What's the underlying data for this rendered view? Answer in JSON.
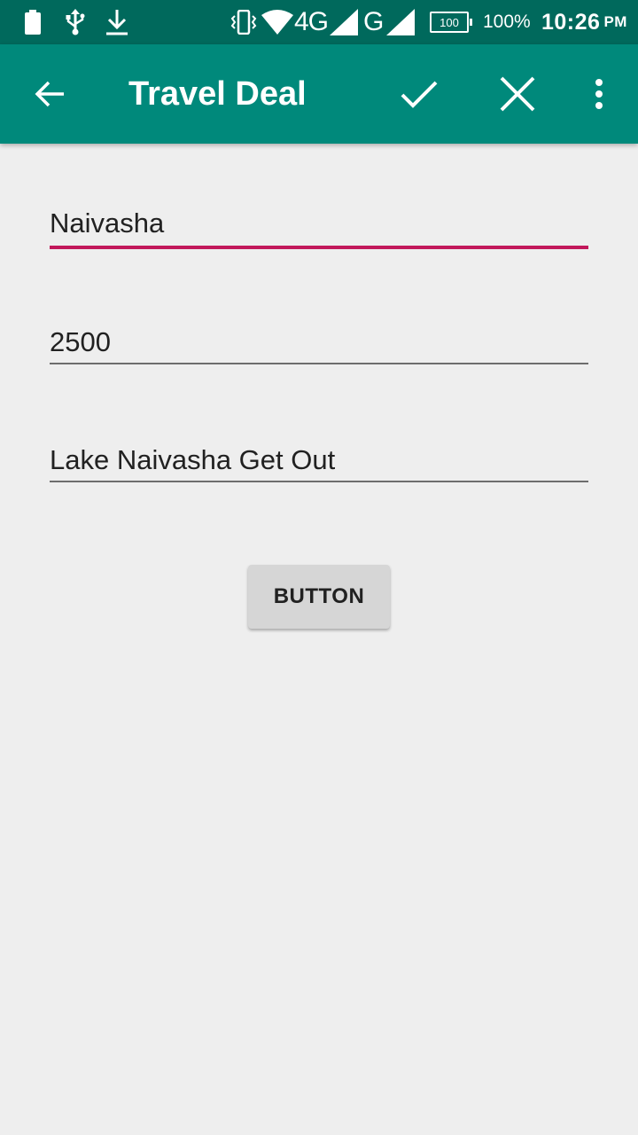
{
  "status_bar": {
    "network_4g": "4G",
    "network_g": "G",
    "battery_box": "100",
    "battery_percent": "100%",
    "time": "10:26",
    "ampm": "PM",
    "icons": [
      "battery-icon",
      "usb-icon",
      "download-icon",
      "vibrate-icon",
      "wifi-icon",
      "signal-icon",
      "signal-icon",
      "battery-icon"
    ]
  },
  "toolbar": {
    "title": "Travel Deal",
    "icons": [
      "back-arrow-icon",
      "check-icon",
      "close-icon",
      "more-vert-icon"
    ]
  },
  "form": {
    "title_value": "Naivasha",
    "price_value": "2500",
    "description_value": "Lake Naivasha Get Out",
    "button_label": "BUTTON"
  },
  "colors": {
    "status_bar": "#00695c",
    "toolbar": "#00897b",
    "accent": "#c2185b",
    "background": "#eeeeee"
  }
}
